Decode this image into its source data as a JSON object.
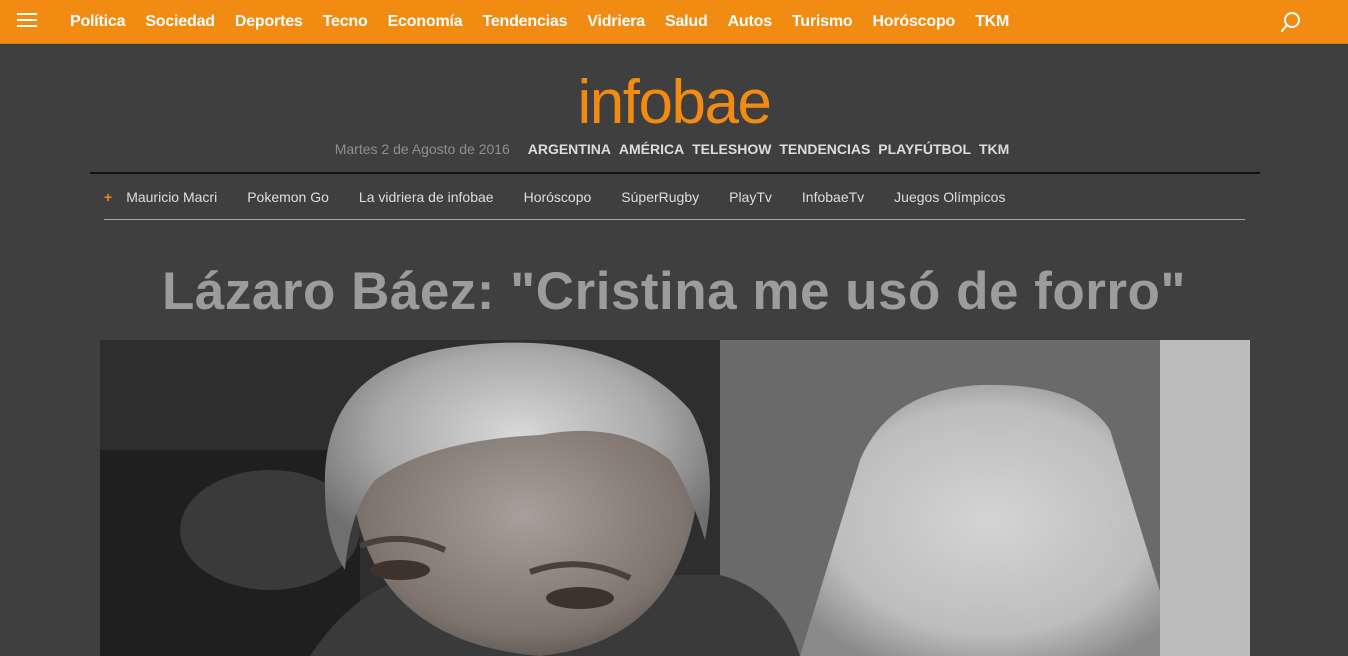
{
  "topnav": {
    "items": [
      "Política",
      "Sociedad",
      "Deportes",
      "Tecno",
      "Economía",
      "Tendencias",
      "Vidriera",
      "Salud",
      "Autos",
      "Turismo",
      "Horóscopo",
      "TKM"
    ],
    "menu_icon": "hamburger-menu-icon",
    "search_icon": "search-icon"
  },
  "masthead": {
    "logo": "infobae",
    "date": "Martes 2 de Agosto de 2016",
    "sections": [
      "ARGENTINA",
      "AMÉRICA",
      "TELESHOW",
      "TENDENCIAS",
      "PLAYFÚTBOL",
      "TKM"
    ]
  },
  "tags": {
    "marker": "+",
    "items": [
      "Mauricio Macri",
      "Pokemon Go",
      "La vidriera de infobae",
      "Horóscopo",
      "SúperRugby",
      "PlayTv",
      "InfobaeTv",
      "Juegos Olímpicos"
    ]
  },
  "article": {
    "headline": "Lázaro Báez: \"Cristina me usó de forro\""
  },
  "colors": {
    "brand": "#f18b11",
    "background": "#3f3f3f",
    "headline": "#9c9c9c"
  }
}
